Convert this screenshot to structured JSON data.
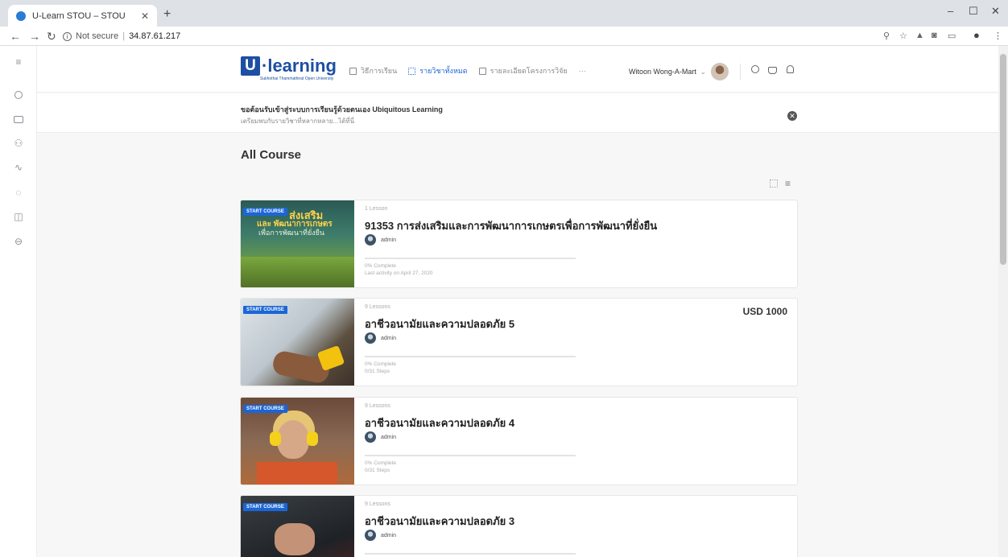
{
  "browser": {
    "tab_title": "U-Learn STOU – STOU",
    "security_label": "Not secure",
    "url": "34.87.61.217",
    "window_controls": [
      "–",
      "☐",
      "✕"
    ]
  },
  "header": {
    "logo_letter": "U",
    "logo_text": "·learning",
    "logo_subtitle": "Sukhothai Thammathirat Open University",
    "nav": [
      {
        "label": "วิธีการเรียน",
        "active": false
      },
      {
        "label": "รายวิชาทั้งหมด",
        "active": true
      },
      {
        "label": "รายละเอียดโครงการวิจัย",
        "active": false
      }
    ],
    "more": "···",
    "user_name": "Witoon Wong-A-Mart",
    "accent_color": "#1b66d6"
  },
  "banner": {
    "title": "ขอต้อนรับเข้าสู่ระบบการเรียนรู้ด้วยตนเอง Ubiquitous Learning",
    "subtitle": "เตรียมพบกับรายวิชาที่หลากหลาย...ได้ที่นี่"
  },
  "page": {
    "title": "All Course"
  },
  "courses": [
    {
      "badge": "START COURSE",
      "lessons": "1 Lesson",
      "title": "91353 การส่งเสริมและการพัฒนาการเกษตรเพื่อการพัฒนาที่ยั่งยืน",
      "author": "admin",
      "progress_label": "0% Complete",
      "progress": 0,
      "meta": "Last activity on April 27, 2020",
      "price": "",
      "thumb_text": [
        "ส่งเสริม",
        "และ พัฒนาการเกษตร",
        "เพื่อการพัฒนาที่ยั่งยืน"
      ]
    },
    {
      "badge": "START COURSE",
      "lessons": "9 Lessons",
      "title": "อาชีวอนามัยและความปลอดภัย 5",
      "author": "admin",
      "progress_label": "0% Complete",
      "progress": 0,
      "meta": "0/31 Steps",
      "price": "USD 1000"
    },
    {
      "badge": "START COURSE",
      "lessons": "9 Lessons",
      "title": "อาชีวอนามัยและความปลอดภัย 4",
      "author": "admin",
      "progress_label": "0% Complete",
      "progress": 0,
      "meta": "0/31 Steps",
      "price": ""
    },
    {
      "badge": "START COURSE",
      "lessons": "9 Lessons",
      "title": "อาชีวอนามัยและความปลอดภัย 3",
      "author": "admin",
      "progress_label": "",
      "progress": 0,
      "meta": "",
      "price": ""
    }
  ]
}
